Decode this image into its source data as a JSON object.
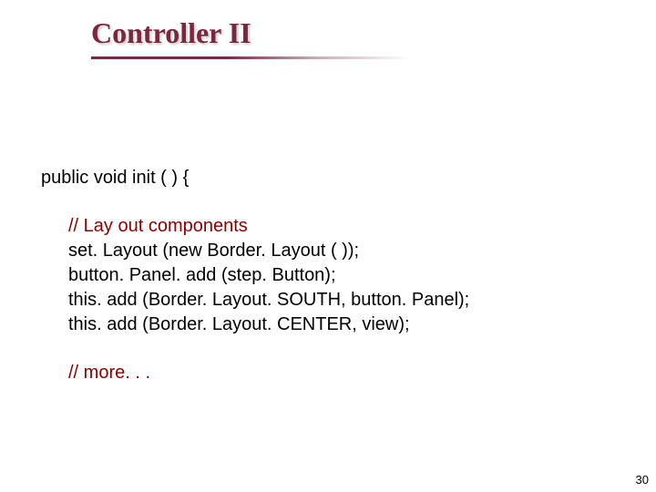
{
  "title": "Controller II",
  "sig": "public void init ( ) {",
  "comment1": "// Lay out components",
  "line1": "set. Layout (new Border. Layout ( ));",
  "line2": "button. Panel. add (step. Button);",
  "line3": "this. add (Border. Layout. SOUTH, button. Panel);",
  "line4": "this. add (Border. Layout. CENTER, view);",
  "comment2": "// more. . .",
  "page": "30"
}
